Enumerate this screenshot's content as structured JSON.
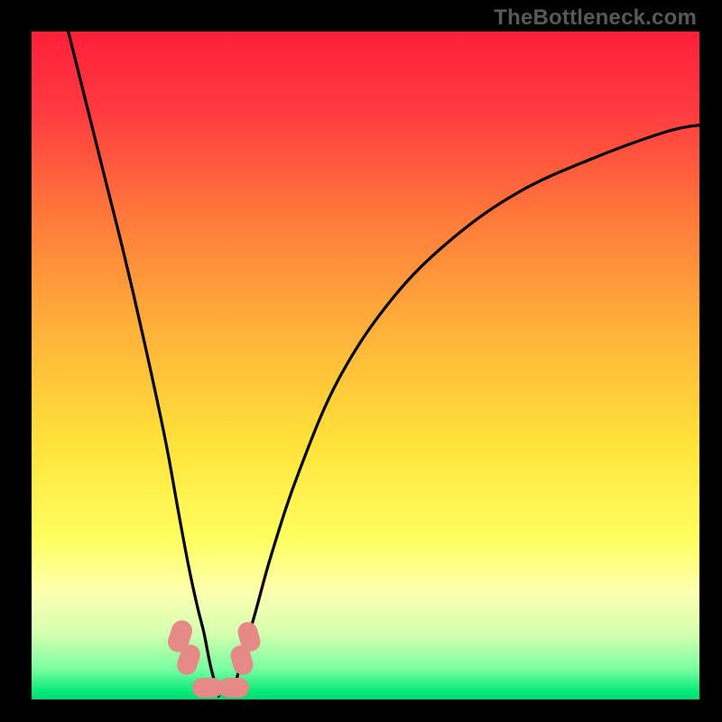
{
  "attribution": "TheBottleneck.com",
  "gradient_stops": [
    {
      "offset": 0.0,
      "color": "#ff1f3a"
    },
    {
      "offset": 0.12,
      "color": "#ff3b40"
    },
    {
      "offset": 0.28,
      "color": "#ff7a3a"
    },
    {
      "offset": 0.45,
      "color": "#ffb23a"
    },
    {
      "offset": 0.62,
      "color": "#ffe33a"
    },
    {
      "offset": 0.76,
      "color": "#ffff60"
    },
    {
      "offset": 0.84,
      "color": "#fdffb0"
    },
    {
      "offset": 0.9,
      "color": "#d6ffb0"
    },
    {
      "offset": 0.955,
      "color": "#78ffa0"
    },
    {
      "offset": 0.99,
      "color": "#00e878"
    },
    {
      "offset": 1.0,
      "color": "#00da72"
    }
  ],
  "sausage_color": "#e58a87",
  "chart_data": {
    "type": "line",
    "title": "",
    "xlabel": "",
    "ylabel": "",
    "xlim": [
      0,
      100
    ],
    "ylim": [
      0,
      100
    ],
    "series": [
      {
        "name": "left-limb",
        "x": [
          5.5,
          8,
          11,
          14,
          17,
          20,
          22,
          23.5,
          24.8,
          25.8,
          26.8,
          28.0
        ],
        "y": [
          100,
          90,
          78,
          66,
          53,
          39,
          28,
          20,
          14,
          10,
          5,
          0.5
        ]
      },
      {
        "name": "right-limb",
        "x": [
          30.0,
          31.5,
          33.5,
          36,
          40,
          46,
          54,
          63,
          73,
          84,
          95,
          100
        ],
        "y": [
          0.5,
          6,
          13,
          22,
          34,
          48,
          60,
          69,
          76,
          81,
          85,
          86
        ]
      }
    ],
    "highlight_points": [
      {
        "x": 22.5,
        "y": 8.5
      },
      {
        "x": 23.8,
        "y": 5.0
      },
      {
        "x": 26.5,
        "y": 1.0
      },
      {
        "x": 29.5,
        "y": 1.0
      },
      {
        "x": 31.3,
        "y": 6.0
      },
      {
        "x": 32.0,
        "y": 9.5
      }
    ]
  }
}
